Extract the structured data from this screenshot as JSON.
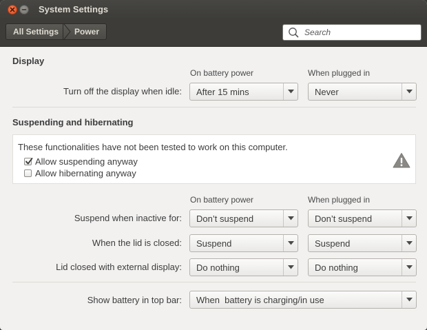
{
  "window": {
    "title": "System Settings"
  },
  "breadcrumb": {
    "items": [
      "All Settings",
      "Power"
    ]
  },
  "search": {
    "placeholder": "Search"
  },
  "display": {
    "title": "Display",
    "col_battery": "On battery power",
    "col_plugged": "When plugged in",
    "row": {
      "label": "Turn off the display when idle:",
      "battery": "After 15 mins",
      "plugged": "Never"
    }
  },
  "suspend": {
    "title": "Suspending and hibernating",
    "notice": "These functionalities have not been tested to work on this computer.",
    "allow_suspend": {
      "label": "Allow suspending anyway",
      "checked": true
    },
    "allow_hibernate": {
      "label": "Allow hibernating anyway",
      "checked": false
    },
    "col_battery": "On battery power",
    "col_plugged": "When plugged in",
    "rows": [
      {
        "label": "Suspend when inactive for:",
        "battery": "Don’t suspend",
        "plugged": "Don’t suspend"
      },
      {
        "label": "When the lid is closed:",
        "battery": "Suspend",
        "plugged": "Suspend"
      },
      {
        "label": "Lid closed with external display:",
        "battery": "Do nothing",
        "plugged": "Do nothing"
      }
    ]
  },
  "battery_bar": {
    "label": "Show battery in top bar:",
    "value": "When  battery is charging/in use"
  },
  "colors": {
    "accent_close": "#df4a16",
    "titlebar": "#3d3c38",
    "background": "#f2f1f0"
  },
  "icons": {
    "close": "close-icon",
    "minimize": "minimize-icon",
    "search": "search-icon",
    "warning": "warning-icon",
    "dropdown": "chevron-down-icon"
  }
}
